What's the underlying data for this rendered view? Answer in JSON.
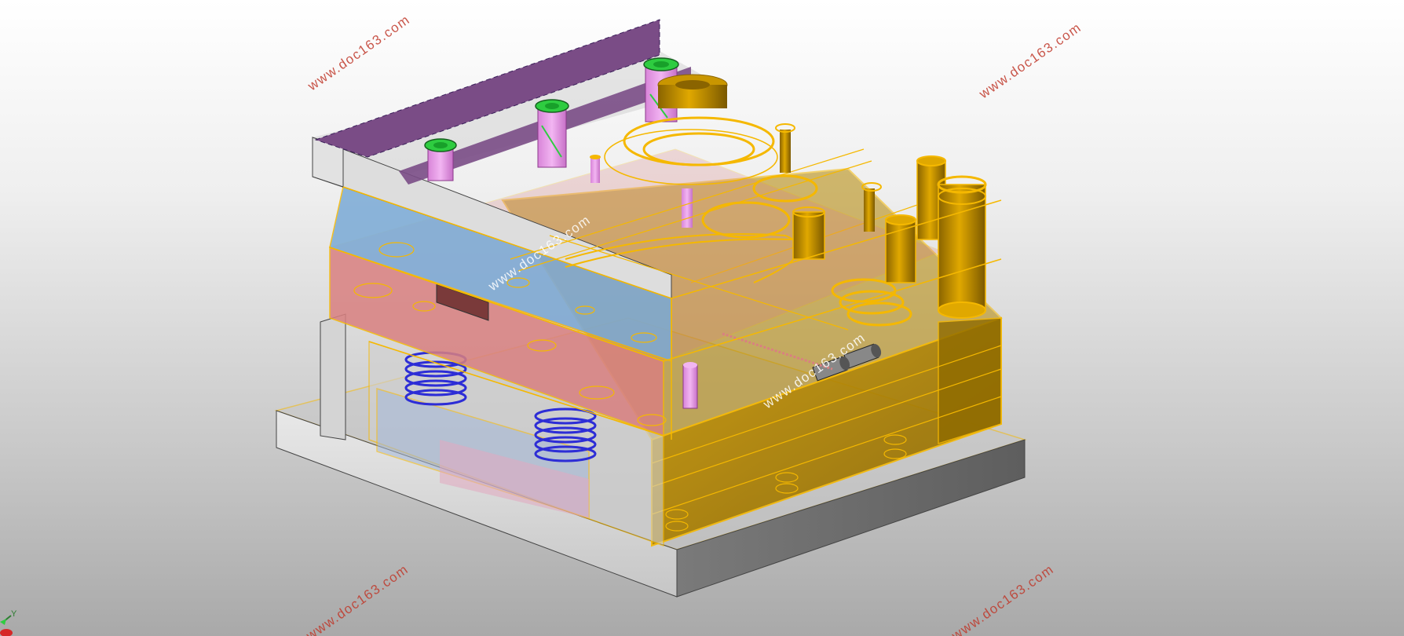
{
  "watermark": {
    "text_top_left": "www.doc163.com",
    "text_top_right": "www.doc163.com",
    "text_center_upper": "www.doc163.com",
    "text_center_lower": "www.doc163.com",
    "text_bottom_left": "www.doc163.com",
    "text_bottom_right": "www.doc163.com"
  },
  "axis_triad": {
    "label": "Y"
  },
  "colors": {
    "background_top": "#ffffff",
    "background_bottom": "#a9a9a9",
    "mold_outline": "#f5b800",
    "mold_fill": "#b38600",
    "top_plate": "#7a4c86",
    "blue_plate": "#7aaad6",
    "red_plate": "#d98080",
    "screw_pink": "#e69ee6",
    "screw_green": "#2ecc40",
    "spring_blue": "#2d2dd6",
    "grey_plate": "#d4d4d4",
    "watermark": "#c0392b"
  }
}
